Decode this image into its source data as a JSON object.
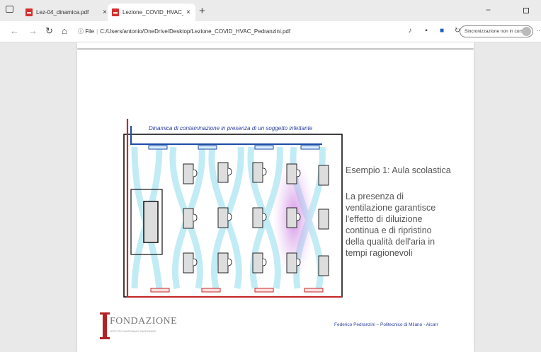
{
  "tabs": [
    {
      "title": "Lez-04_dinamica.pdf",
      "close": "×",
      "active": false
    },
    {
      "title": "Lezione_COVID_HVAC_Pedranzini",
      "close": "×",
      "active": true
    }
  ],
  "new_tab": "+",
  "window": {
    "minimize": "−"
  },
  "address": {
    "prefix": "File",
    "url": "C:/Users/antonio/OneDrive/Desktop/Lezione_COVID_HVAC_Pedranzini.pdf"
  },
  "sync": {
    "label": "Sincronizzazione non in corso"
  },
  "slide": {
    "caption": "Dinamica di contaminazione in presenza di un soggetto infettante",
    "aside_title": "Esempio 1: Aula scolastica",
    "aside_lines": [
      "La presenza di",
      "ventilazione garantisce",
      "l'effetto di diluizione",
      "continua e di ripristino",
      "della qualità dell'aria in",
      "tempi ragionevoli"
    ],
    "logo_name": "FONDAZIONE",
    "logo_sub": "ISTITUTO NAZIONALE INGEGNERI",
    "footer": "Federico Pedranzini – Politecnico di Milano - Aicarr",
    "colors": {
      "supply": "#1f4fa8",
      "return": "#c62828",
      "airflow": "#aee6f2",
      "contamination": "#d79be8",
      "text_blue": "#2e3fa0"
    }
  }
}
